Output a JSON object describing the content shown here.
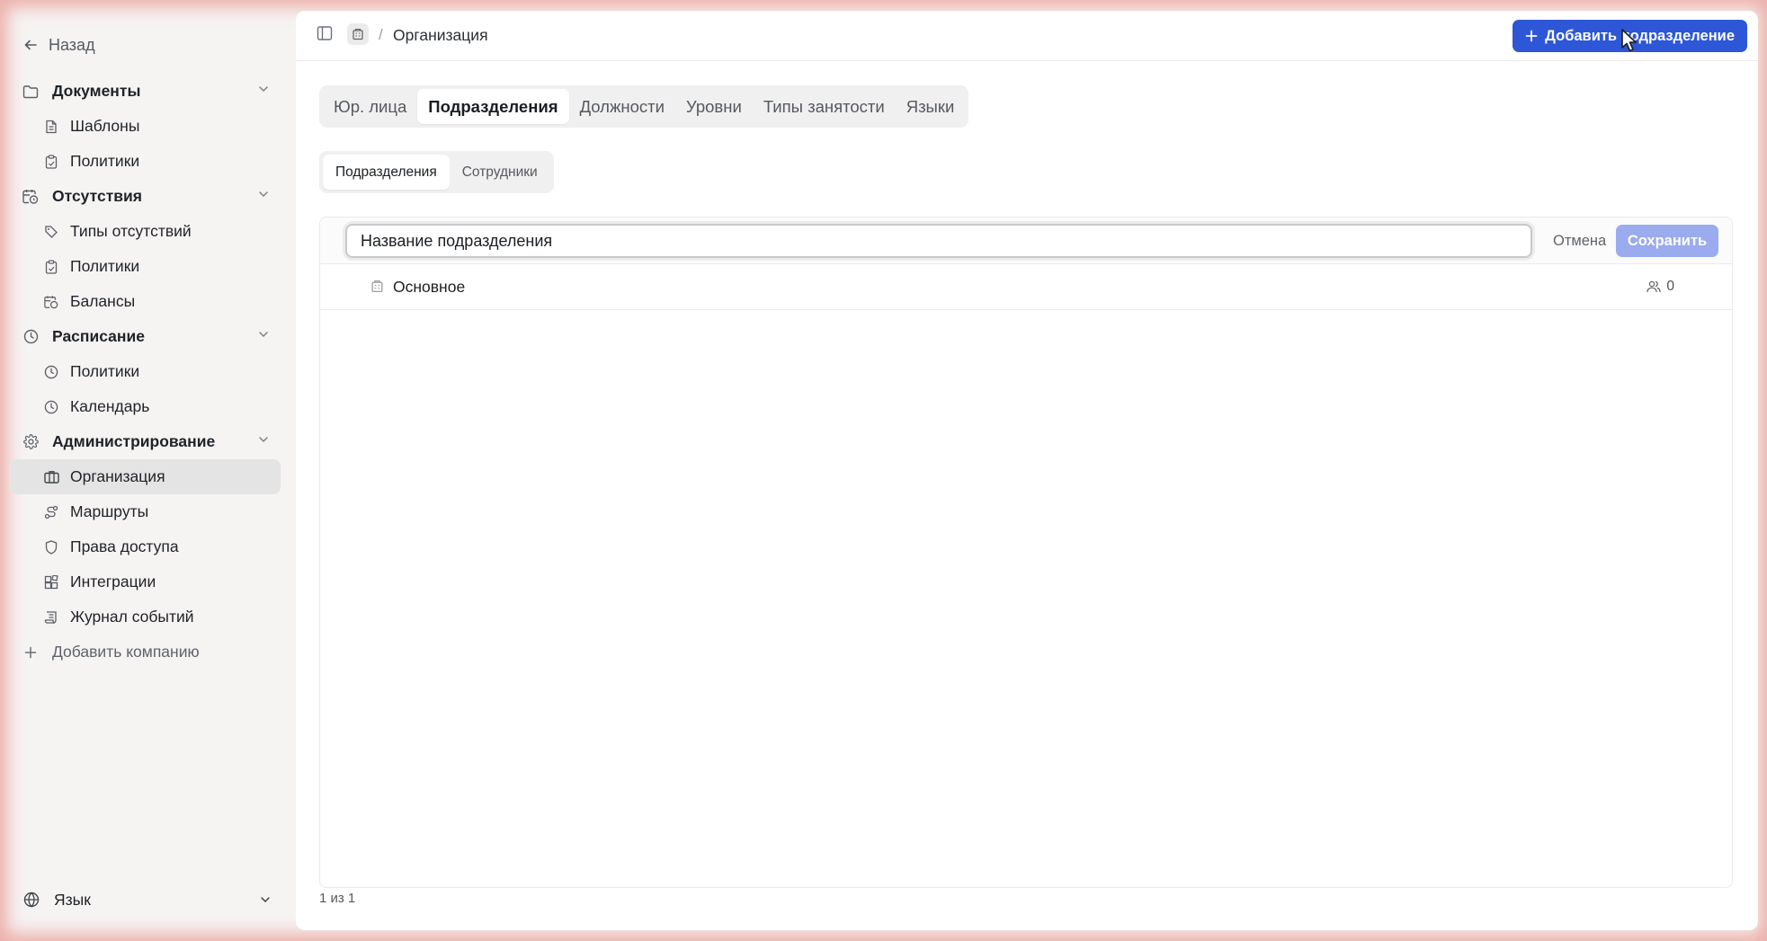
{
  "sidebar": {
    "back_label": "Назад",
    "groups": [
      {
        "label": "Документы",
        "icon": "folder-icon",
        "items": [
          {
            "label": "Шаблоны",
            "icon": "document-icon"
          },
          {
            "label": "Политики",
            "icon": "clipboard-icon"
          }
        ]
      },
      {
        "label": "Отсутствия",
        "icon": "calendar-clock-icon",
        "items": [
          {
            "label": "Типы отсутствий",
            "icon": "tags-icon"
          },
          {
            "label": "Политики",
            "icon": "clipboard-icon"
          },
          {
            "label": "Балансы",
            "icon": "calendar-clock-icon"
          }
        ]
      },
      {
        "label": "Расписание",
        "icon": "clock-icon",
        "items": [
          {
            "label": "Политики",
            "icon": "clock-icon"
          },
          {
            "label": "Календарь",
            "icon": "clock-icon"
          }
        ]
      },
      {
        "label": "Администрирование",
        "icon": "gear-icon",
        "items": [
          {
            "label": "Организация",
            "icon": "briefcase-icon"
          },
          {
            "label": "Маршруты",
            "icon": "route-icon"
          },
          {
            "label": "Права доступа",
            "icon": "shield-icon"
          },
          {
            "label": "Интеграции",
            "icon": "blocks-icon"
          },
          {
            "label": "Журнал событий",
            "icon": "scroll-icon"
          }
        ]
      }
    ],
    "add_company_label": "Добавить компанию",
    "language_label": "Язык"
  },
  "header": {
    "breadcrumb_separator": "/",
    "breadcrumb_current": "Организация",
    "add_button_label": "Добавить подразделение"
  },
  "tabs": [
    "Юр. лица",
    "Подразделения",
    "Должности",
    "Уровни",
    "Типы занятости",
    "Языки"
  ],
  "active_tab": "Подразделения",
  "subtabs": [
    "Подразделения",
    "Сотрудники"
  ],
  "active_subtab": "Подразделения",
  "edit_row": {
    "input_value": "Название подразделения",
    "cancel_label": "Отмена",
    "save_label": "Сохранить"
  },
  "rows": [
    {
      "name": "Основное",
      "employee_count": "0"
    }
  ],
  "pagination": "1 из 1",
  "colors": {
    "accent": "#2d57d6",
    "save_disabled": "#9aabee",
    "active_nav": "#e5e4e4"
  }
}
